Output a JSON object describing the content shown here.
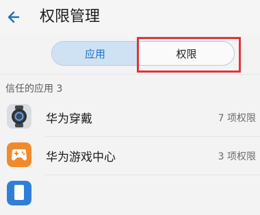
{
  "header": {
    "title": "权限管理"
  },
  "tabs": [
    {
      "label": "应用",
      "selected": true
    },
    {
      "label": "权限",
      "selected": false
    }
  ],
  "section": {
    "title": "信任的应用 3"
  },
  "apps": [
    {
      "name": "华为穿戴",
      "permissions": "7 项权限",
      "icon": "watch-icon"
    },
    {
      "name": "华为游戏中心",
      "permissions": "3 项权限",
      "icon": "gamepad-icon"
    },
    {
      "name": "",
      "permissions": "",
      "icon": "app-icon"
    }
  ],
  "colors": {
    "accent": "#1b6fc4",
    "selected_tab_bg": "#cfe2f3",
    "highlight": "#e0333a",
    "game_icon": "#f08a2c"
  }
}
